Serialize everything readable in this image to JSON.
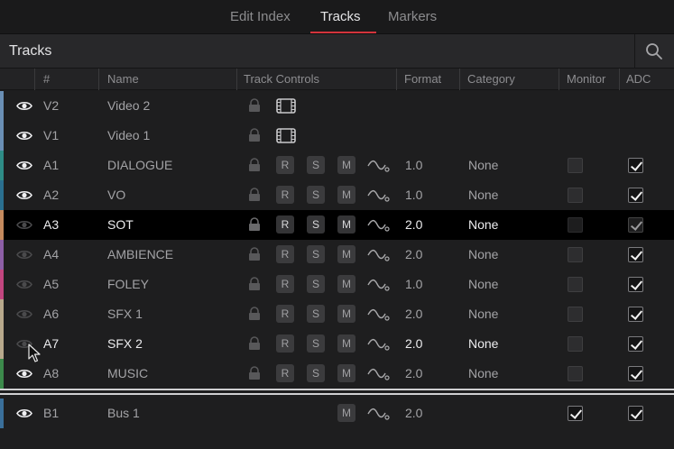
{
  "tabs": [
    {
      "label": "Edit Index",
      "active": false
    },
    {
      "label": "Tracks",
      "active": true
    },
    {
      "label": "Markers",
      "active": false
    }
  ],
  "panel": {
    "title": "Tracks",
    "search_icon": "search-icon"
  },
  "columns": {
    "id": "#",
    "name": "Name",
    "controls": "Track Controls",
    "format": "Format",
    "category": "Category",
    "monitor": "Monitor",
    "adc": "ADC"
  },
  "button_labels": {
    "record": "R",
    "solo": "S",
    "mute": "M"
  },
  "colors": {
    "accent": "#d3343c",
    "video": "#6a8fb5",
    "dialogue": "#2e8c86",
    "vo": "#2a6f8f",
    "sot": "#c48a5e",
    "ambience": "#8d5fa6",
    "foley": "#c2467f",
    "sfx": "#b8a98c",
    "music": "#3c8a4b",
    "bus": "#3a6f9a"
  },
  "tracks": [
    {
      "id": "V2",
      "name": "Video 2",
      "type": "video",
      "visible": true,
      "format": "",
      "category": "",
      "monitor": null,
      "adc": null,
      "color": "#6a8fb5"
    },
    {
      "id": "V1",
      "name": "Video 1",
      "type": "video",
      "visible": true,
      "format": "",
      "category": "",
      "monitor": null,
      "adc": null,
      "color": "#6a8fb5"
    },
    {
      "id": "A1",
      "name": "DIALOGUE",
      "type": "audio",
      "visible": true,
      "format": "1.0",
      "category": "None",
      "monitor": false,
      "adc": true,
      "color": "#2e8c86"
    },
    {
      "id": "A2",
      "name": "VO",
      "type": "audio",
      "visible": true,
      "format": "1.0",
      "category": "None",
      "monitor": false,
      "adc": true,
      "color": "#2a6f8f"
    },
    {
      "id": "A3",
      "name": "SOT",
      "type": "audio",
      "visible": false,
      "format": "2.0",
      "category": "None",
      "monitor": false,
      "adc": true,
      "color": "#c48a5e",
      "selected": true
    },
    {
      "id": "A4",
      "name": "AMBIENCE",
      "type": "audio",
      "visible": false,
      "format": "2.0",
      "category": "None",
      "monitor": false,
      "adc": true,
      "color": "#8d5fa6"
    },
    {
      "id": "A5",
      "name": "FOLEY",
      "type": "audio",
      "visible": false,
      "format": "1.0",
      "category": "None",
      "monitor": false,
      "adc": true,
      "color": "#c2467f"
    },
    {
      "id": "A6",
      "name": "SFX 1",
      "type": "audio",
      "visible": false,
      "format": "2.0",
      "category": "None",
      "monitor": false,
      "adc": true,
      "color": "#b8a98c"
    },
    {
      "id": "A7",
      "name": "SFX 2",
      "type": "audio",
      "visible": false,
      "format": "2.0",
      "category": "None",
      "monitor": false,
      "adc": true,
      "color": "#b8a98c",
      "bright": true
    },
    {
      "id": "A8",
      "name": "MUSIC",
      "type": "audio",
      "visible": true,
      "format": "2.0",
      "category": "None",
      "monitor": false,
      "adc": true,
      "color": "#3c8a4b"
    },
    {
      "id": "B1",
      "name": "Bus 1",
      "type": "bus",
      "visible": true,
      "format": "2.0",
      "category": "",
      "monitor": true,
      "adc": true,
      "color": "#3a6f9a"
    }
  ]
}
